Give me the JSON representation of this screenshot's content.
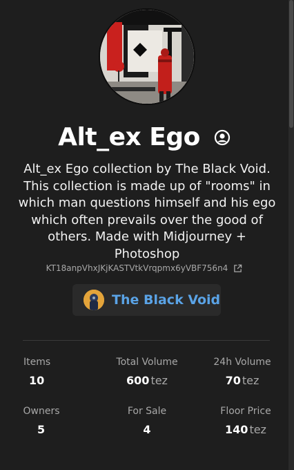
{
  "collection": {
    "title": "Alt_ex Ego",
    "description": "Alt_ex Ego collection by The Black Void. This collection is made up of \"rooms\" in which man questions himself and his ego which often prevails over the good of others. Made with Midjourney + Photoshop",
    "contract": "KT18anpVhxJKjKASTVtkVrqpmx6yVBF756n4",
    "creator": "The Black Void"
  },
  "icons": {
    "owner": "user-circle-icon",
    "contract_link": "external-link-icon"
  },
  "stats": {
    "items": {
      "label": "Items",
      "value": "10"
    },
    "total_volume": {
      "label": "Total Volume",
      "value": "600",
      "unit": "tez"
    },
    "volume_24h": {
      "label": "24h Volume",
      "value": "70",
      "unit": "tez"
    },
    "owners": {
      "label": "Owners",
      "value": "5"
    },
    "for_sale": {
      "label": "For Sale",
      "value": "4"
    },
    "floor_price": {
      "label": "Floor Price",
      "value": "140",
      "unit": "tez"
    }
  },
  "colors": {
    "background": "#1e1e1e",
    "creator_link": "#5aa3e6",
    "muted_text": "#a8a8a8"
  }
}
